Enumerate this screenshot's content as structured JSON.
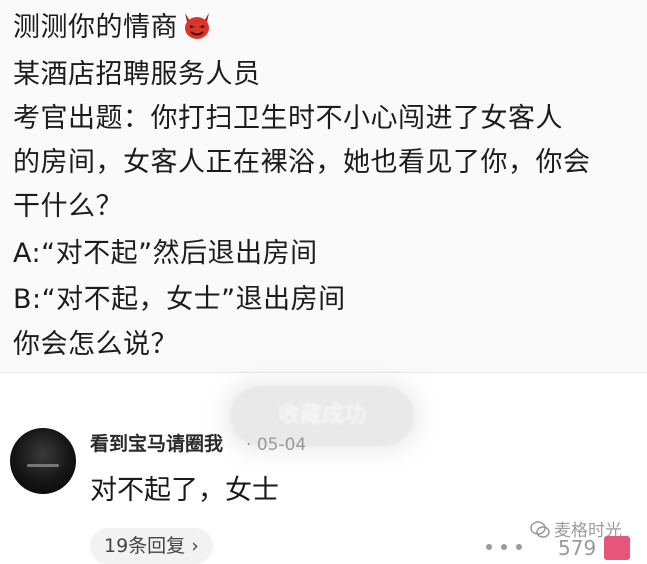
{
  "post": {
    "lines": [
      "测测你的情商",
      "某酒店招聘服务人员",
      "考官出题：你打扫卫生时不小心闯进了女客人",
      "的房间，女客人正在裸浴，她也看见了你，你会",
      "干什么？",
      "A:“对不起”然后退出房间",
      "B:“对不起，女士”退出房间",
      "你会怎么说？"
    ],
    "title_icon": "devil-emoji-icon"
  },
  "toast": {
    "text": "收藏成功"
  },
  "comment": {
    "username": "看到宝马请圈我",
    "separator": "·",
    "date": "05-04",
    "text": "对不起了，女士",
    "replies_label": "19条回复",
    "replies_arrow": "›",
    "likes": "579"
  },
  "watermark": {
    "text": "麦格时光"
  },
  "colors": {
    "like_accent": "#e6567a",
    "devil_red": "#d9362b"
  }
}
